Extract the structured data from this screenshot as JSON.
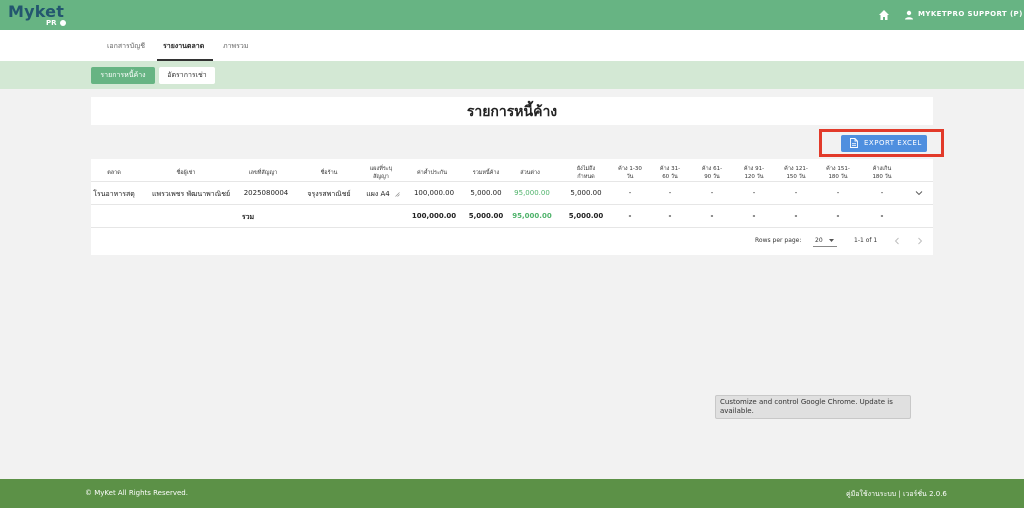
{
  "app": {
    "logo_text": "Myket",
    "logo_sub": "PR",
    "user_label": "MYKETPRO SUPPORT (P)"
  },
  "nav": {
    "tabs": [
      {
        "label": "เอกสารบัญชี",
        "active": false
      },
      {
        "label": "รายงานตลาด",
        "active": true
      },
      {
        "label": "ภาพรวม",
        "active": false
      }
    ]
  },
  "subnav": {
    "tabs": [
      {
        "label": "รายการหนี้ค้าง",
        "active": true
      },
      {
        "label": "อัตราการเช่า",
        "active": false
      }
    ]
  },
  "page": {
    "title": "รายการหนี้ค้าง",
    "export_label": "EXPORT EXCEL"
  },
  "table": {
    "headers": [
      [
        "ตลาด"
      ],
      [
        "ชื่อผู้เช่า"
      ],
      [
        "เลขที่สัญญา"
      ],
      [
        "ชื่อร้าน"
      ],
      [
        "แผงที่ระบุ",
        "สัญญา"
      ],
      [
        "ค่าค้ำประกัน"
      ],
      [
        "รวมหนี้ค้าง"
      ],
      [
        "ส่วนต่าง"
      ],
      [
        "ยังไม่ถึง",
        "กำหนด"
      ],
      [
        "ค้าง 1-30",
        "วัน"
      ],
      [
        "ค้าง 31-",
        "60 วัน"
      ],
      [
        "ค้าง 61-",
        "90 วัน"
      ],
      [
        "ค้าง 91-",
        "120 วัน"
      ],
      [
        "ค้าง 121-",
        "150 วัน"
      ],
      [
        "ค้าง 151-",
        "180 วัน"
      ],
      [
        "ค้างเกิน",
        "180 วัน"
      ]
    ],
    "rows": [
      {
        "market": "โรนอาหารสดุ",
        "tenant": "แพรวเพชร พัฒนาพาณิชย์",
        "contract_no": "2025080004",
        "shop": "จรุงรสพาณิชย์",
        "stall": "แผง A4",
        "deposit": "100,000.00",
        "total_debt": "5,000.00",
        "difference": "95,000.00",
        "not_due": "5,000.00",
        "d1_30": "-",
        "d31_60": "-",
        "d61_90": "-",
        "d91_120": "-",
        "d121_150": "-",
        "d151_180": "-",
        "d180_plus": "-"
      }
    ],
    "total_row": {
      "label": "รวม",
      "deposit": "100,000.00",
      "total_debt": "5,000.00",
      "difference": "95,000.00",
      "not_due": "5,000.00",
      "d1_30": "-",
      "d31_60": "-",
      "d61_90": "-",
      "d91_120": "-",
      "d121_150": "-",
      "d151_180": "-",
      "d180_plus": "-"
    }
  },
  "pagination": {
    "rows_per_page_label": "Rows per page:",
    "rows_per_page_value": "20",
    "range": "1-1 of 1"
  },
  "tooltip": {
    "text": "Customize and control Google Chrome. Update is available."
  },
  "footer": {
    "copyright": "© MyKet All Rights Reserved.",
    "right": "คู่มือใช้งานระบบ | เวอร์ชั่น 2.0.6"
  },
  "colors": {
    "brand_green": "#67b483",
    "subbar_green": "#d3e8d4",
    "footer_green": "#5c9147",
    "accent_blue": "#4f8fdf",
    "highlight_red": "#e23a2a",
    "positive_green": "#4fb36b"
  }
}
